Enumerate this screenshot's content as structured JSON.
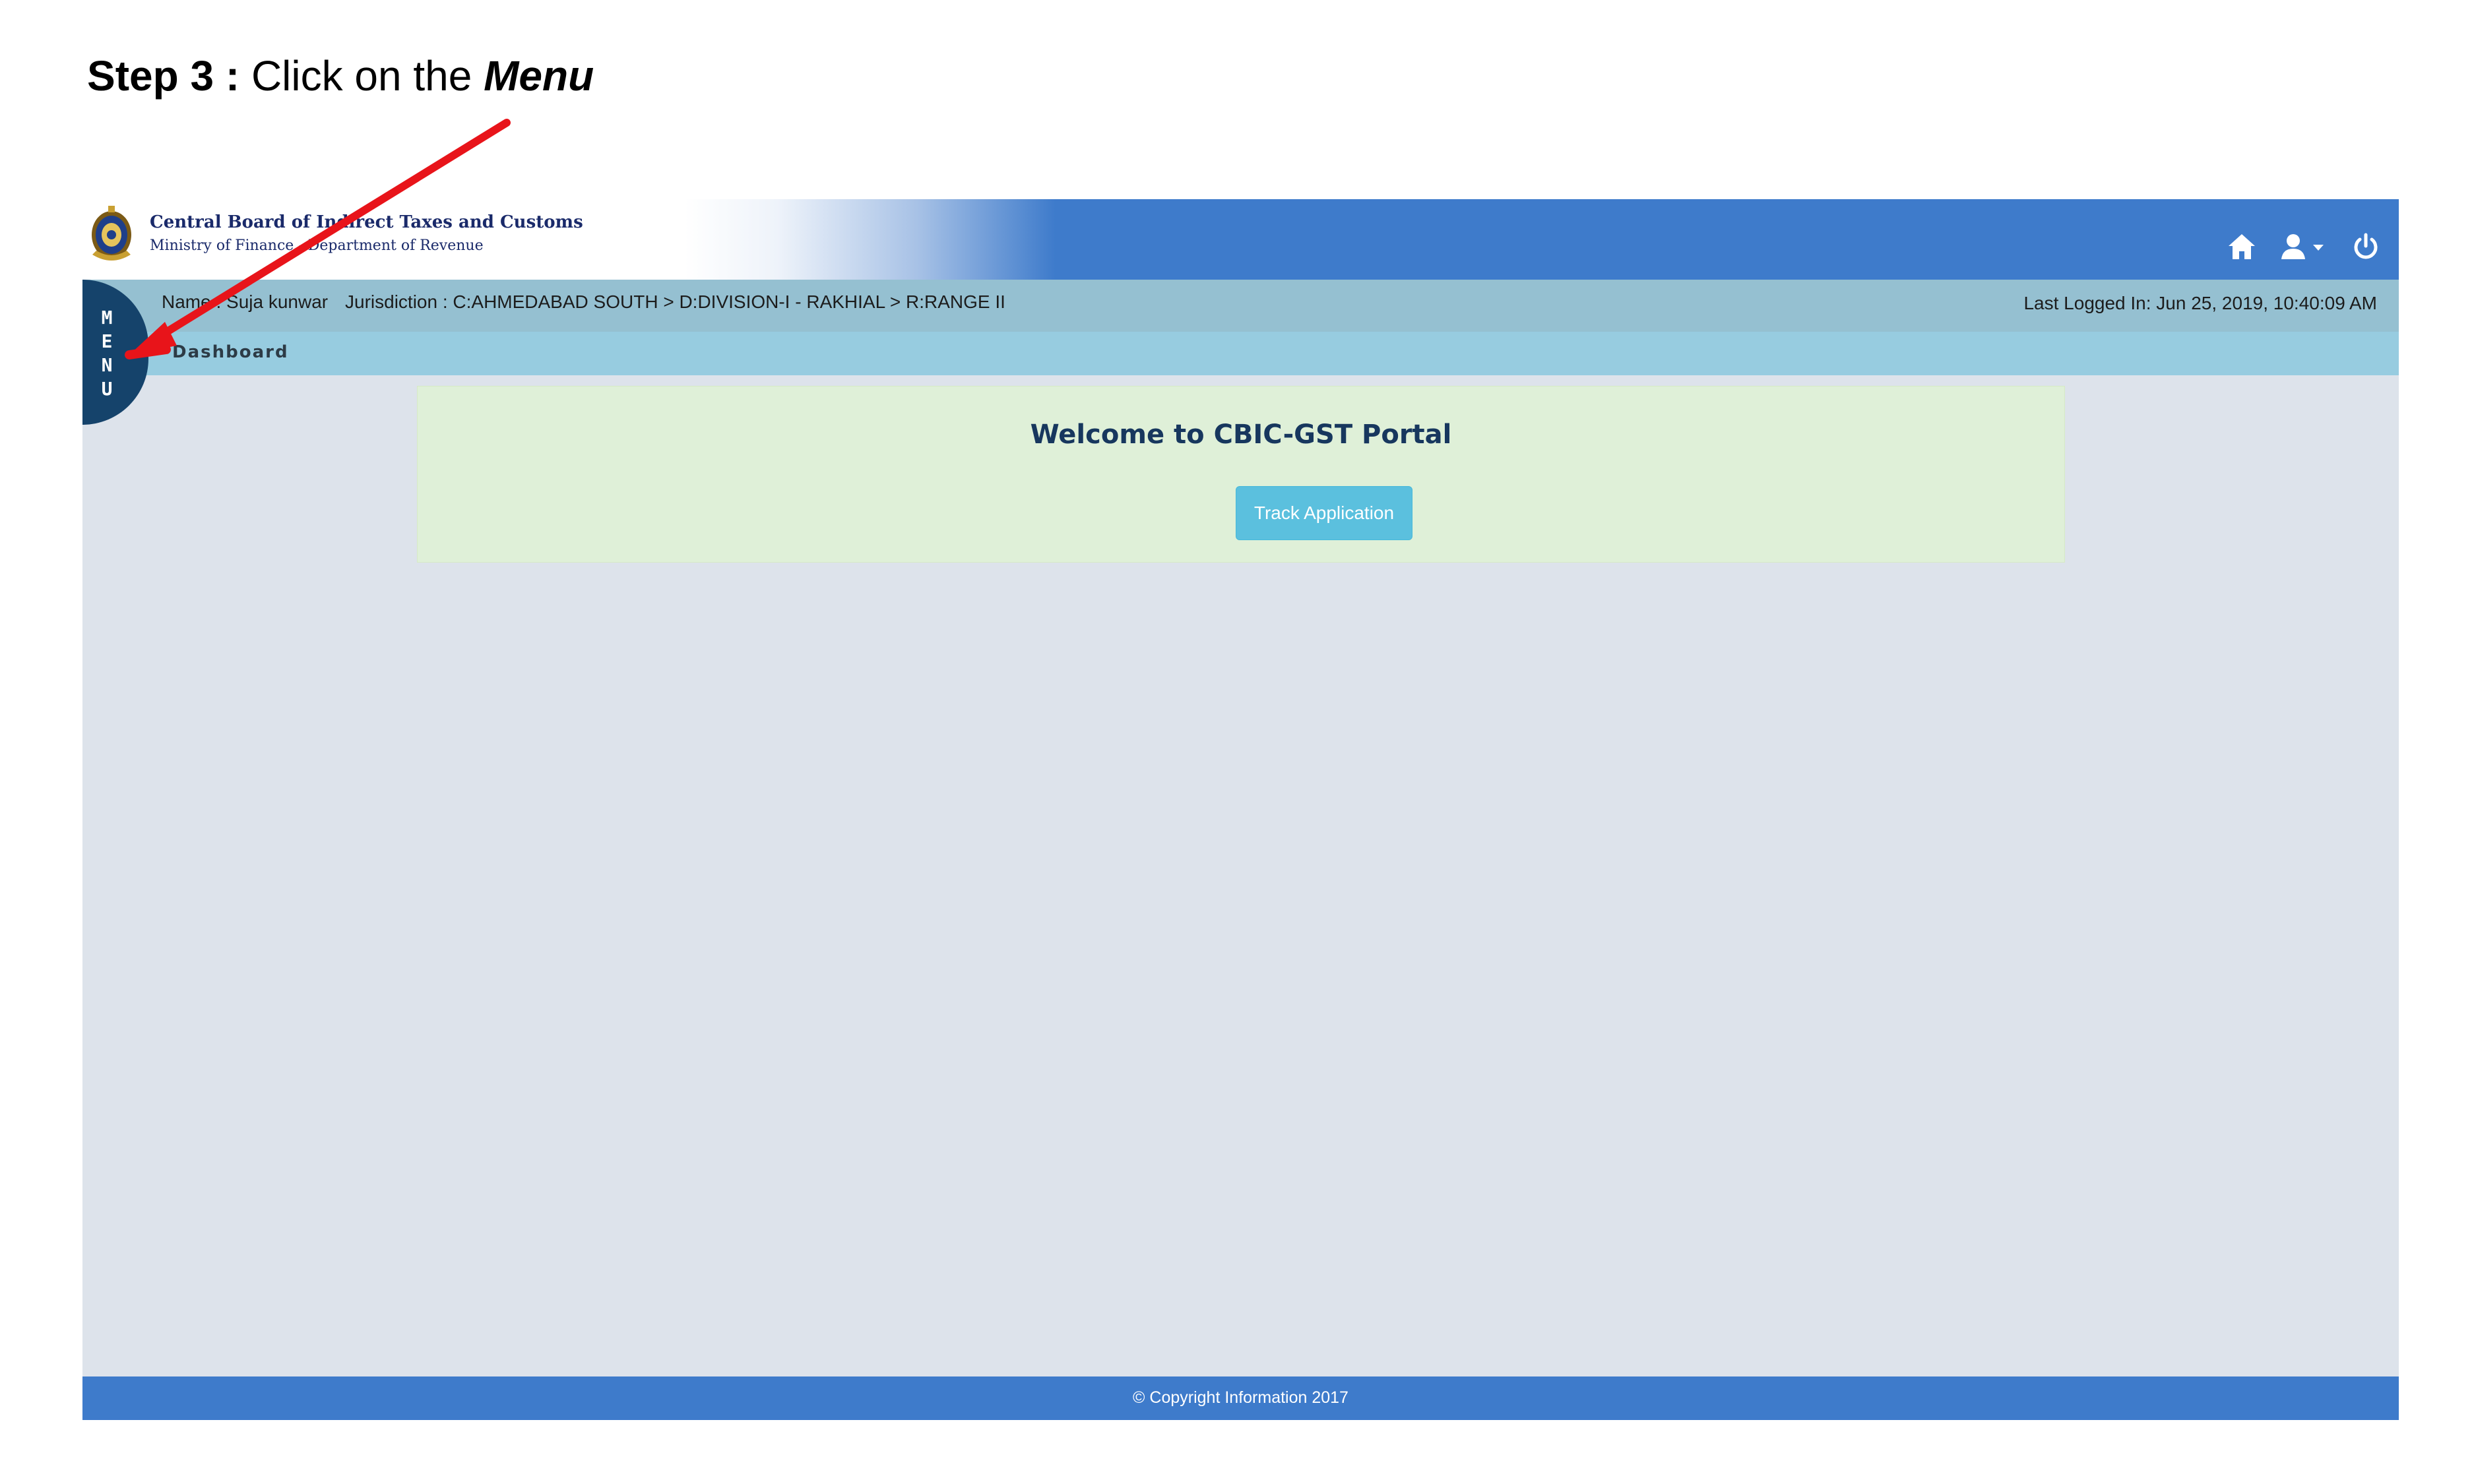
{
  "caption": {
    "step": "Step 3 :",
    "text": " Click on the ",
    "emphasis": "Menu"
  },
  "header": {
    "org_title": "Central Board of Indirect Taxes and Customs",
    "org_subtitle": "Ministry of Finance - Department of Revenue",
    "icons": [
      "home-icon",
      "user-dropdown-icon",
      "power-icon"
    ],
    "bg_color": "#3e7bcb"
  },
  "info_bar": {
    "user": "Name : Suja kunwar",
    "jurisdiction": "Jurisdiction : C:AHMEDABAD SOUTH > D:DIVISION-I - RAKHIAL > R:RANGE II",
    "last_logged": "Last Logged In: Jun 25, 2019, 10:40:09 AM"
  },
  "breadcrumb": {
    "current": "Dashboard"
  },
  "menu_tab": {
    "letters": [
      "M",
      "E",
      "N",
      "U"
    ],
    "color": "#15436b"
  },
  "welcome": {
    "title": "Welcome to CBIC-GST Portal",
    "button_label": "Track Application",
    "panel_color": "#dff0d8",
    "button_color": "#5bc0de"
  },
  "footer": {
    "copyright": "© Copyright Information 2017"
  },
  "annotation": {
    "arrow_color": "#e8141a"
  }
}
